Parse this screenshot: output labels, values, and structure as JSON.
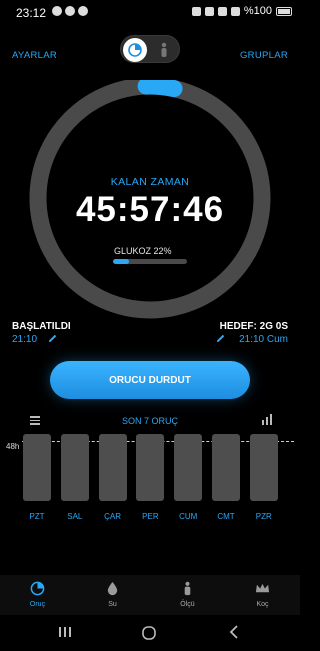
{
  "status_bar": {
    "time": "23:12",
    "battery_text": "%100"
  },
  "header": {
    "left_link": "AYARLAR",
    "right_link": "GRUPLAR"
  },
  "timer": {
    "label": "KALAN ZAMAN",
    "value": "45:57:46",
    "glucose_label": "GLUKOZ 22%",
    "glucose_percent": 22,
    "ring_progress_percent": 4
  },
  "start": {
    "title": "BAŞLATILDI",
    "time": "21:10"
  },
  "goal": {
    "title": "HEDEF: 2G 0S",
    "time": "21:10 Cum"
  },
  "main_button": "ORUCU DURDUT",
  "history": {
    "title": "SON 7 ORUÇ",
    "hours_label": "48h",
    "days": [
      "PZT",
      "SAL",
      "ÇAR",
      "PER",
      "CUM",
      "CMT",
      "PZR"
    ]
  },
  "bottom_nav": [
    {
      "label": "Oruç",
      "icon": "fasting-timer-icon",
      "active": true
    },
    {
      "label": "Su",
      "icon": "water-drop-icon",
      "active": false
    },
    {
      "label": "Ölçü",
      "icon": "body-measure-icon",
      "active": false
    },
    {
      "label": "Koç",
      "icon": "crown-icon",
      "active": false
    }
  ],
  "colors": {
    "accent": "#29a8f5",
    "ring_track": "#4a4a4a",
    "background": "#000000"
  }
}
